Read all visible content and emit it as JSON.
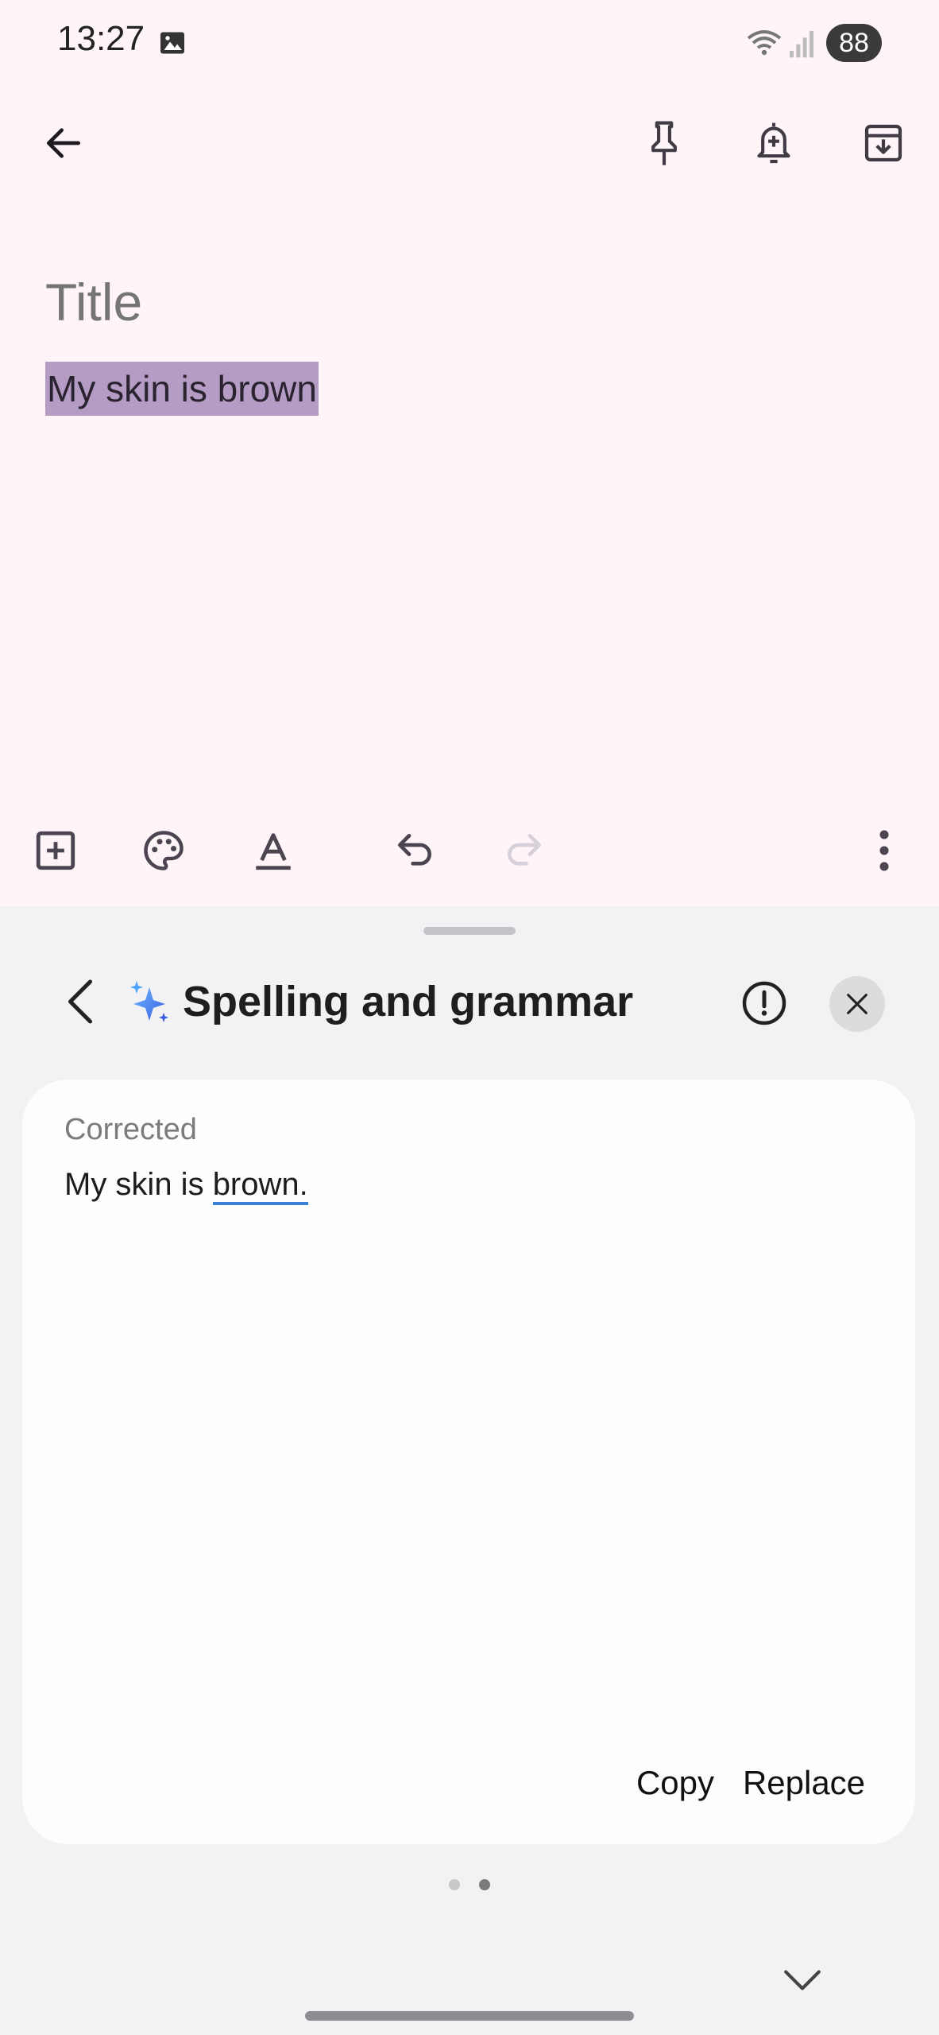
{
  "status_bar": {
    "time": "13:27",
    "battery": "88",
    "icons": [
      "image-icon",
      "wifi-icon",
      "signal-icon"
    ]
  },
  "app_bar": {
    "icons": [
      "back-arrow-icon",
      "pin-icon",
      "add-reminder-icon",
      "archive-icon"
    ]
  },
  "note": {
    "title_placeholder": "Title",
    "body": "My skin is brown"
  },
  "editor_toolbar": {
    "icons": [
      "add-box-icon",
      "palette-icon",
      "text-format-icon",
      "undo-icon",
      "redo-icon",
      "more-vert-icon"
    ]
  },
  "sheet": {
    "title": "Spelling and grammar",
    "card": {
      "label": "Corrected",
      "text_prefix": "My skin is ",
      "text_corrected": "brown."
    },
    "copy_label": "Copy",
    "replace_label": "Replace",
    "pager": {
      "pages": 2,
      "active": 2
    }
  },
  "colors": {
    "background": "#fff5f8",
    "selection": "#b49cc4",
    "sheet": "#f2f1f3",
    "underline": "#3c7fd6"
  }
}
